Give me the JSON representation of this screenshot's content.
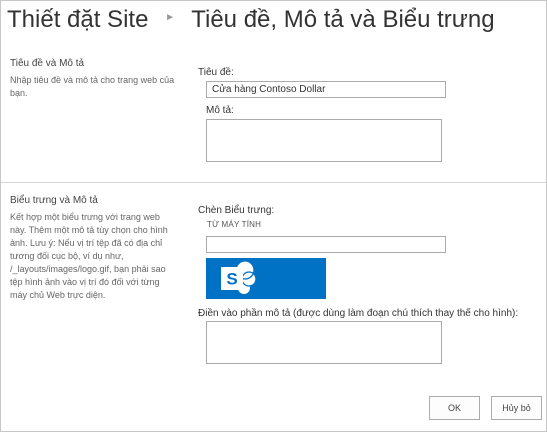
{
  "header": {
    "breadcrumb_root": "Thiết đặt Site",
    "page_title": "Tiêu đề, Mô tả và Biểu trưng"
  },
  "title_section": {
    "heading": "Tiêu đề và Mô tả",
    "description": "Nhập tiêu đề và mô tả cho trang web của bạn.",
    "title_label": "Tiêu đề:",
    "title_value": "Cửa hàng Contoso Dollar",
    "description_label": "Mô tả:",
    "description_value": ""
  },
  "logo_section": {
    "heading": "Biểu trưng và Mô tả",
    "description": "Kết hợp một biểu trưng với trang web này. Thêm một mô tả tùy chọn cho hình ảnh. Lưu ý: Nếu vị trí tệp đã có địa chỉ tương đối cục bộ, ví dụ như, /_layouts/images/logo.gif, bạn phải sao tệp hình ảnh vào vị trí đó đối với từng máy chủ Web trực diện.",
    "insert_logo_label": "Chèn Biểu trưng:",
    "from_computer_label": "TỪ MÁY TÍNH",
    "logo_url_value": "",
    "alt_text_label": "Điền vào phần mô tả (được dùng làm đoạn chú thích thay thế cho hình):",
    "alt_text_value": "",
    "logo_color": "#0072c6"
  },
  "actions": {
    "ok_label": "OK",
    "cancel_label": "Hủy bỏ"
  }
}
